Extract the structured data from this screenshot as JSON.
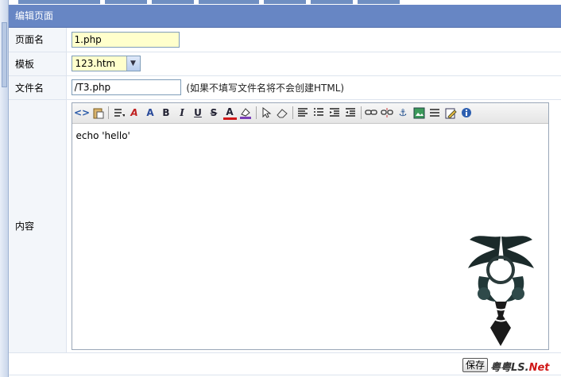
{
  "panel": {
    "title": "编辑页面"
  },
  "fields": {
    "page_name": {
      "label": "页面名",
      "value": "1.php"
    },
    "template": {
      "label": "模板",
      "value": "123.htm"
    },
    "file_name": {
      "label": "文件名",
      "value": "/T3.php",
      "hint": "(如果不填写文件名将不会创建HTML)"
    },
    "content": {
      "label": "内容",
      "text": "echo 'hello'"
    }
  },
  "toolbar": {
    "icons": [
      "source-icon",
      "paste-icon",
      "format-icon",
      "spellcheck-icon",
      "font-size-icon",
      "bold-icon",
      "italic-icon",
      "underline-icon",
      "strikethrough-icon",
      "font-color-icon",
      "highlight-icon",
      "select-icon",
      "eraser-icon",
      "align-icon",
      "list-icon",
      "outdent-icon",
      "indent-icon",
      "link-icon",
      "unlink-icon",
      "anchor-icon",
      "image-icon",
      "hr-icon",
      "edit-icon",
      "info-icon"
    ],
    "glyphs": {
      "bold": "B",
      "italic": "I",
      "underline": "U",
      "strike": "S",
      "color": "A"
    }
  },
  "actions": {
    "save_label": "保存"
  },
  "watermark": {
    "text": "粤粤LS.",
    "net": "Net"
  },
  "colors": {
    "header": "#6786c4",
    "field_yellow": "#ffffcc"
  }
}
